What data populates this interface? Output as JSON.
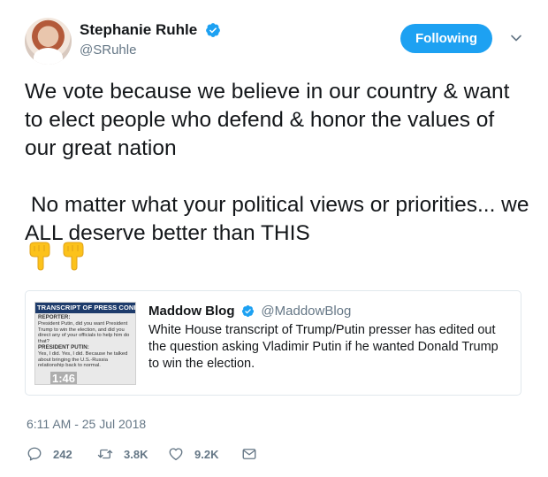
{
  "user": {
    "display_name": "Stephanie Ruhle",
    "handle": "@SRuhle",
    "follow_label": "Following"
  },
  "tweet": {
    "text": "We vote because we believe in our country & want to elect people who defend & honor the values of our great nation\n\n No matter what your political views or priorities... we ALL deserve better than THIS",
    "emojis": [
      "👇",
      "👇"
    ]
  },
  "card": {
    "name": "Maddow Blog",
    "handle": "@MaddowBlog",
    "text": "White House transcript of Trump/Putin presser has edited out the question asking Vladimir Putin if he wanted Donald Trump to win the election.",
    "media": {
      "header": "TRANSCRIPT OF PRESS CONFERENCE",
      "reporter_label": "REPORTER:",
      "reporter_text": "President Putin, did you want President Trump to win the election, and did you direct any of your officials to help him do that?",
      "putin_label": "PRESIDENT PUTIN:",
      "putin_text": "Yes, I did. Yes, I did. Because he talked about bringing the U.S.-Russia relationship back to normal.",
      "duration": "1:46"
    }
  },
  "timestamp": "6:11 AM - 25 Jul 2018",
  "actions": {
    "replies": "242",
    "retweets": "3.8K",
    "likes": "9.2K"
  },
  "colors": {
    "accent": "#1da1f2",
    "secondary_text": "#657786",
    "border": "#e1e8ed"
  },
  "icons": [
    "verified-icon",
    "chevron-down-icon",
    "reply-icon",
    "retweet-icon",
    "like-icon",
    "message-icon"
  ]
}
